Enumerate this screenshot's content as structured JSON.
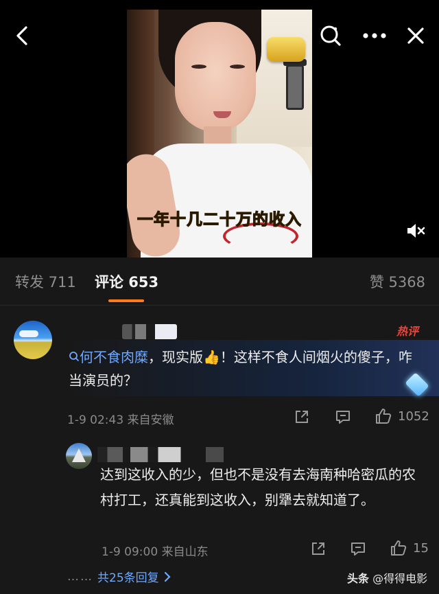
{
  "video": {
    "subtitle": "一年十几二十万的收入",
    "icons": {
      "back": "back-arrow-icon",
      "search": "search-icon",
      "more": "more-dots-icon",
      "close": "close-icon",
      "mute": "volume-muted-icon"
    }
  },
  "tabs": {
    "repost": "转发 711",
    "comments": "评论 653",
    "likes": "赞 5368"
  },
  "comment": {
    "hot_badge": "热评",
    "text_link": "何不食肉糜",
    "text_rest": "，现实版👍！这样不食人间烟火的傻子，咋当演员的？",
    "meta": "1-9 02:43  来自安徽",
    "like_count": "1052"
  },
  "reply": {
    "text": "达到这收入的少，但也不是没有去海南种哈密瓜的农村打工，还真能到这收入，别犟去就知道了。",
    "meta": "1-9 09:00  来自山东",
    "like_count": "15",
    "more_dots": "……",
    "more_label": "共25条回复"
  },
  "watermark": {
    "brand": "头条",
    "handle": "@得得电影"
  },
  "colors": {
    "accent": "#ff7a1a",
    "link": "#6fa8ff",
    "hot": "#e8463a",
    "subtitle": "#ffe23a"
  }
}
